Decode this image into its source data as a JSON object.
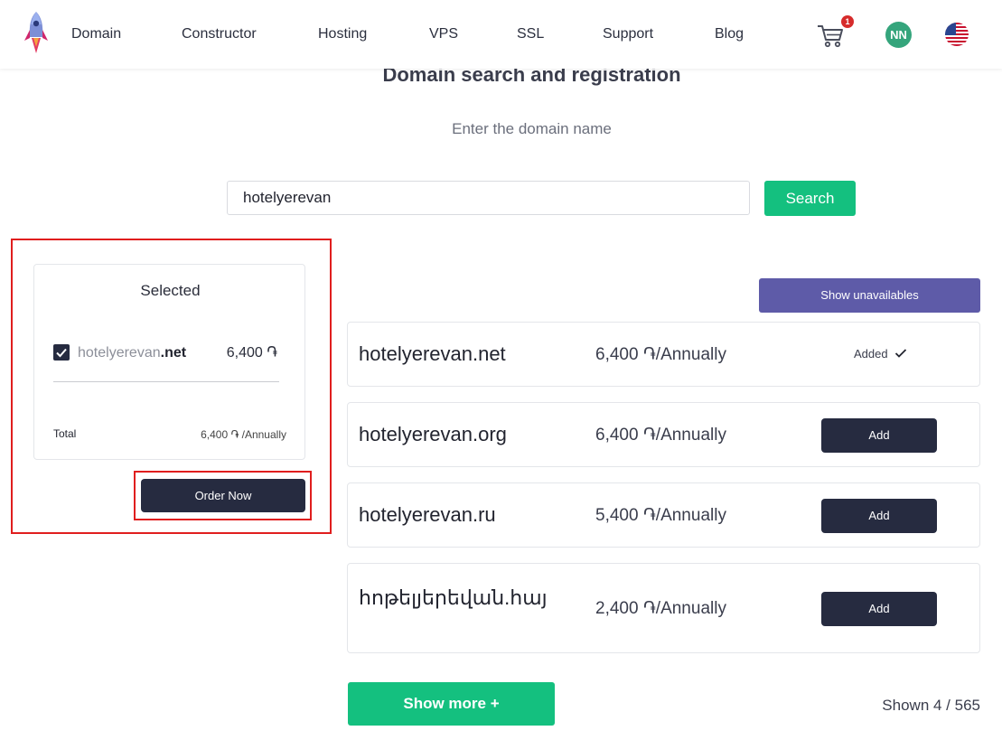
{
  "nav": {
    "items": [
      "Domain",
      "Constructor",
      "Hosting",
      "VPS",
      "SSL",
      "Support",
      "Blog"
    ],
    "cart_count": "1",
    "avatar_initials": "NN",
    "language_flag": "us-flag-icon"
  },
  "header": {
    "title": "Domain search and registration",
    "subtitle": "Enter the domain name"
  },
  "search": {
    "value": "hotelyerevan",
    "button_label": "Search"
  },
  "selected": {
    "title": "Selected",
    "items": [
      {
        "name": "hotelyerevan",
        "tld": ".net",
        "price": "6,400 ֏",
        "checked": true
      }
    ],
    "total_label": "Total",
    "total_value": "6,400 ֏ /Annually",
    "order_button": "Order Now"
  },
  "results": {
    "show_unavailables_label": "Show unavailables",
    "rows": [
      {
        "domain": "hotelyerevan.net",
        "price": "6,400 ֏/Annually",
        "action": "Added",
        "added": true
      },
      {
        "domain": "hotelyerevan.org",
        "price": "6,400 ֏/Annually",
        "action": "Add",
        "added": false
      },
      {
        "domain": "hotelyerevan.ru",
        "price": "5,400 ֏/Annually",
        "action": "Add",
        "added": false
      },
      {
        "domain": "հոթելյերեվան.հայ",
        "price": "2,400 ֏/Annually",
        "action": "Add",
        "added": false
      }
    ],
    "show_more_label": "Show more +",
    "shown_count": "Shown 4 / 565"
  },
  "colors": {
    "accent_green": "#14c07f",
    "dark_navy": "#262b40",
    "purple": "#5e5ba8",
    "highlight_red": "#e01e1e"
  }
}
